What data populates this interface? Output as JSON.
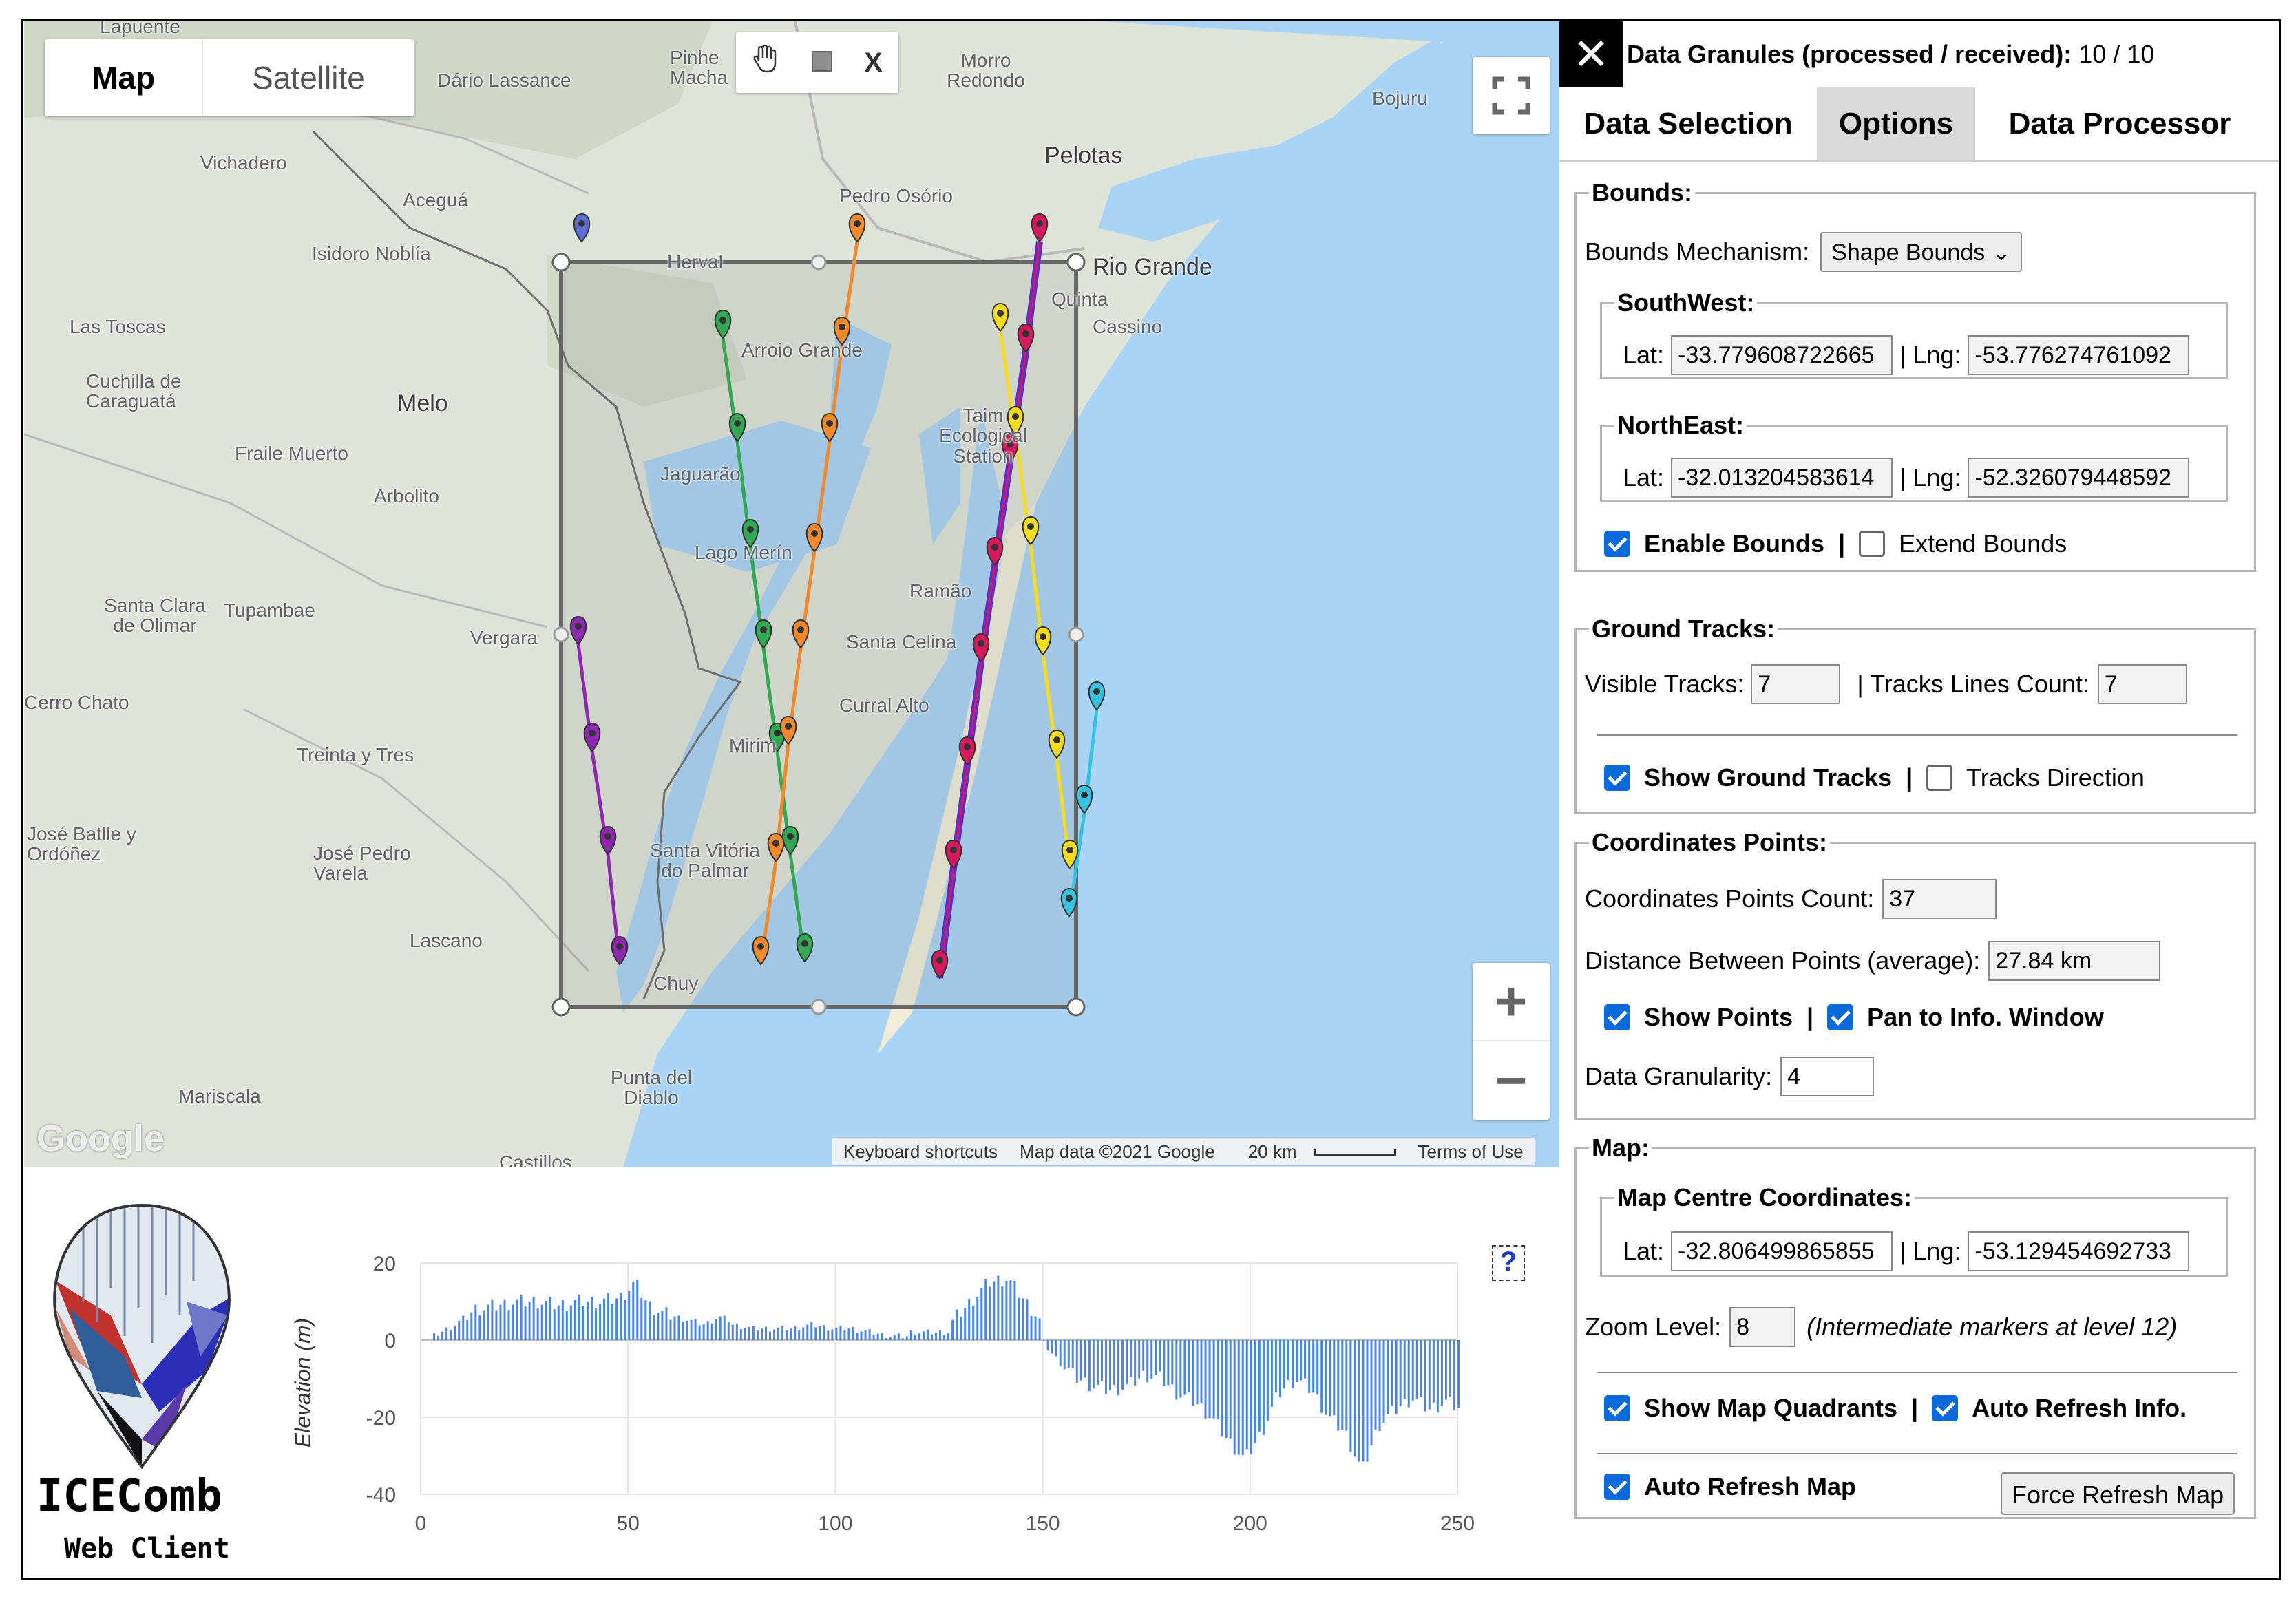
{
  "map": {
    "maptype": {
      "map": "Map",
      "satellite": "Satellite"
    },
    "draw_tools": {
      "close": "X"
    },
    "labels": {
      "lapuente": "Lapuente",
      "dario": "Dário Lassance",
      "pinheiro": "Pinhe\nMacha",
      "morro": "Morro Redondo",
      "bojuru": "Bojuru",
      "vichadero": "Vichadero",
      "pelotas": "Pelotas",
      "pedro": "Pedro Osório",
      "acegua": "Aceguá",
      "isidoro": "Isidoro Noblía",
      "herval": "Herval",
      "riogrande": "Rio Grande",
      "quinta": "Quinta",
      "cassino": "Cassino",
      "lastoscas": "Las Toscas",
      "arroio": "Arroio Grande",
      "cuchilla": "Cuchilla de Caraguatá",
      "melo": "Melo",
      "taim": "Taim Ecological Station",
      "fraile": "Fraile Muerto",
      "jaguarao": "Jaguarão",
      "arbolito": "Arbolito",
      "lagomerin": "Lago Merín",
      "ramao": "Ramão",
      "santaclara": "Santa Clara de Olimar",
      "tupambae": "Tupambae",
      "vergara": "Vergara",
      "santacelina": "Santa Celina",
      "curralalto": "Curral Alto",
      "cerrochato": "Cerro Chato",
      "mirim": "Mirim",
      "treinta": "Treinta y Tres",
      "josebatlle": "José Batlle y Ordóñez",
      "josepedro": "José Pedro Varela",
      "santavitoria": "Santa Vitória do Palmar",
      "lascano": "Lascano",
      "chuy": "Chuy",
      "puntadiablo": "Punta del Diablo",
      "mariscala": "Mariscala",
      "castillos": "Castillos"
    },
    "google": "Google",
    "attribution": {
      "shortcuts": "Keyboard shortcuts",
      "mapdata": "Map data ©2021 Google",
      "scale": "20 km",
      "terms": "Terms of Use"
    },
    "colors": {
      "water": "#a9d4f5",
      "land": "#dfe4d9",
      "bounds": "#666666"
    }
  },
  "panel": {
    "header": {
      "close_icon": "✕",
      "granules_label": "Data Granules (processed / received):",
      "granules_value": "10 / 10"
    },
    "tabs": [
      "Data Selection",
      "Options",
      "Data Processor"
    ],
    "bounds": {
      "legend": "Bounds:",
      "mechanism_label": "Bounds Mechanism:",
      "mechanism_value": "Shape Bounds",
      "southwest": {
        "legend": "SouthWest:",
        "lat_label": "Lat:",
        "lat": "-33.779608722665",
        "lng_label": "| Lng:",
        "lng": "-53.776274761092"
      },
      "northeast": {
        "legend": "NorthEast:",
        "lat_label": "Lat:",
        "lat": "-32.013204583614",
        "lng_label": "| Lng:",
        "lng": "-52.326079448592"
      },
      "enable": "Enable Bounds",
      "extend": "Extend Bounds"
    },
    "ground_tracks": {
      "legend": "Ground Tracks:",
      "visible_label": "Visible Tracks:",
      "visible": "7",
      "lines_label": "| Tracks Lines Count:",
      "lines": "7",
      "show": "Show Ground Tracks",
      "direction": "Tracks Direction"
    },
    "coords": {
      "legend": "Coordinates Points:",
      "count_label": "Coordinates Points Count:",
      "count": "37",
      "distance_label": "Distance Between Points (average):",
      "distance": "27.84 km",
      "show_points": "Show Points",
      "pan": "Pan to Info. Window",
      "granularity_label": "Data Granularity:",
      "granularity": "4"
    },
    "map_opts": {
      "legend": "Map:",
      "centre_legend": "Map Centre Coordinates:",
      "lat_label": "Lat:",
      "lat": "-32.806499865855",
      "lng_label": "| Lng:",
      "lng": "-53.129454692733",
      "zoom_label": "Zoom Level:",
      "zoom": "8",
      "zoom_note": "(Intermediate markers at level 12)",
      "quadrants": "Show Map Quadrants",
      "auto_info": "Auto Refresh Info.",
      "auto_map": "Auto Refresh Map",
      "force": "Force Refresh Map"
    }
  },
  "logo": {
    "title": "ICEComb",
    "subtitle": "Web Client"
  },
  "chart_data": {
    "type": "bar",
    "ylabel": "Elevation (m)",
    "xlabel": "",
    "xlim": [
      0,
      250
    ],
    "ylim": [
      -40,
      20
    ],
    "xticks": [
      0,
      50,
      100,
      150,
      200,
      250
    ],
    "yticks": [
      20,
      0,
      -20,
      -40
    ],
    "help": "?",
    "color": "#4a86e8",
    "segments": [
      {
        "x": [
          3,
          48
        ],
        "level": [
          1,
          4,
          8,
          9,
          10,
          10,
          9,
          10,
          10,
          11
        ]
      },
      {
        "x": [
          48,
          75
        ],
        "level": [
          11,
          15,
          9,
          7,
          6,
          5,
          4,
          6,
          5
        ]
      },
      {
        "x": [
          75,
          118
        ],
        "level": [
          4,
          3,
          3,
          3,
          4,
          3,
          3,
          2,
          1,
          1
        ]
      },
      {
        "x": [
          118,
          128
        ],
        "level": [
          2,
          2,
          2
        ]
      },
      {
        "x": [
          128,
          150
        ],
        "level": [
          5,
          10,
          15,
          16,
          10,
          4
        ]
      },
      {
        "x": [
          150,
          251
        ],
        "level": [
          -1,
          -6,
          -10,
          -12,
          -13,
          -12,
          -9,
          -10,
          -14,
          -16,
          -20,
          -26,
          -31,
          -24,
          -14,
          -10,
          -13,
          -20,
          -24,
          -34,
          -22,
          -18,
          -15,
          -18,
          -16,
          -18
        ]
      }
    ]
  }
}
